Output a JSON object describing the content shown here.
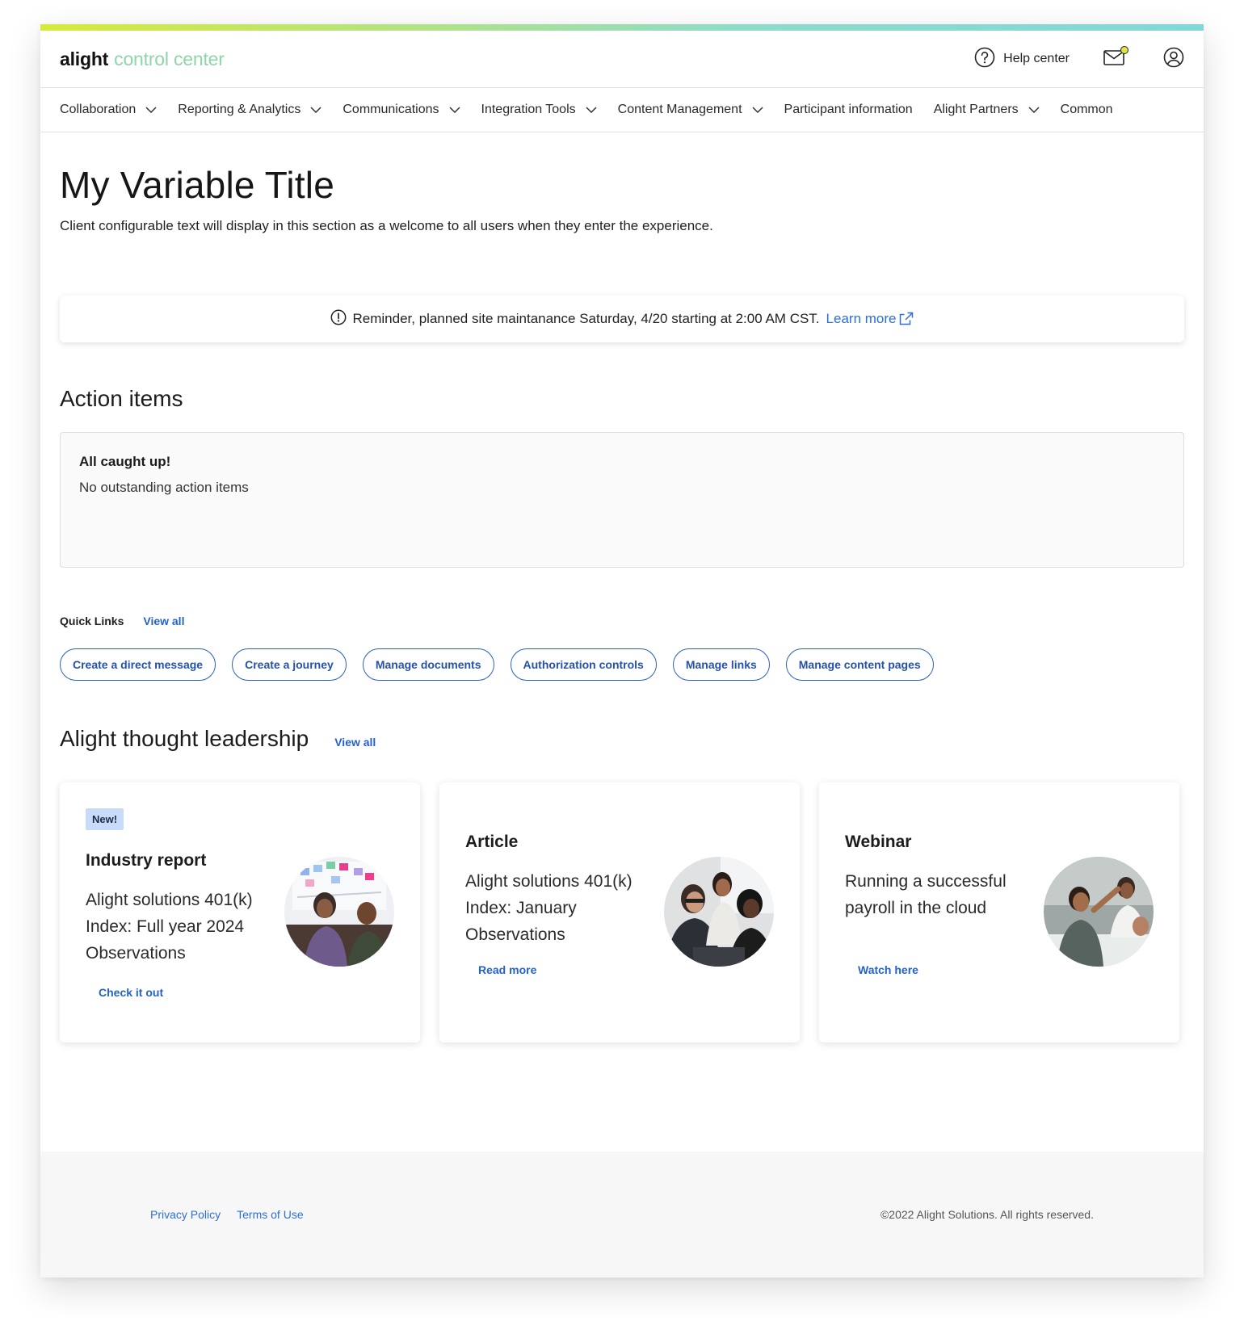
{
  "header": {
    "logo_brand": "alight",
    "logo_product": "control center",
    "help_label": "Help center",
    "icons": [
      "help-icon",
      "mail-icon",
      "user-icon"
    ]
  },
  "nav": {
    "items": [
      {
        "label": "Collaboration",
        "dropdown": true
      },
      {
        "label": "Reporting & Analytics",
        "dropdown": true
      },
      {
        "label": "Communications",
        "dropdown": true
      },
      {
        "label": "Integration Tools",
        "dropdown": true
      },
      {
        "label": "Content Management",
        "dropdown": true
      },
      {
        "label": "Participant information",
        "dropdown": false
      },
      {
        "label": "Alight Partners",
        "dropdown": true
      },
      {
        "label": "Common",
        "dropdown": false
      }
    ]
  },
  "main": {
    "title": "My Variable Title",
    "welcome": "Client configurable text will display in this section as a welcome to all users when they enter the experience.",
    "alert": {
      "text": "Reminder, planned site maintanance Saturday, 4/20 starting at 2:00 AM CST.",
      "link": "Learn more"
    },
    "action_items": {
      "heading": "Action items",
      "status_title": "All caught up!",
      "status_text": "No outstanding action items"
    },
    "quick_links": {
      "label": "Quick Links",
      "view_all": "View all",
      "items": [
        "Create a direct message",
        "Create a journey",
        "Manage documents",
        "Authorization controls",
        "Manage links",
        "Manage content pages"
      ]
    },
    "thought_leadership": {
      "heading": "Alight thought leadership",
      "view_all": "View all",
      "cards": [
        {
          "badge": "New!",
          "type": "Industry report",
          "desc": "Alight solutions 401(k) Index: Full year 2024 Observations",
          "link": "Check it out"
        },
        {
          "badge": "",
          "type": "Article",
          "desc": "Alight solutions 401(k) Index: January Observations",
          "link": "Read more"
        },
        {
          "badge": "",
          "type": "Webinar",
          "desc": "Running a successful payroll in the cloud",
          "link": "Watch here"
        }
      ]
    }
  },
  "footer": {
    "privacy": "Privacy Policy",
    "terms": "Terms of Use",
    "copyright": "©2022 Alight Solutions. All rights reserved."
  },
  "colors": {
    "accent_blue": "#2462c9",
    "logo_green": "#8fd5a8",
    "badge_bg": "#c8dcfa",
    "notification_dot": "#e3e44a"
  }
}
